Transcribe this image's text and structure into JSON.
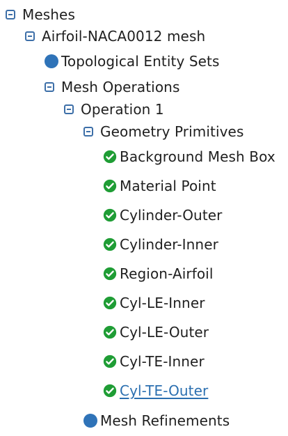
{
  "tree": {
    "root": {
      "label": "Meshes",
      "icon": "collapse-toggle-icon"
    },
    "mesh": {
      "label": "Airfoil-NACA0012 mesh",
      "icon": "collapse-toggle-icon"
    },
    "topological_entity_sets": {
      "label": "Topological Entity Sets",
      "icon": "blue-dot-icon"
    },
    "mesh_operations": {
      "label": "Mesh Operations",
      "icon": "collapse-toggle-icon"
    },
    "operation_1": {
      "label": "Operation 1",
      "icon": "collapse-toggle-icon"
    },
    "geometry_primitives": {
      "label": "Geometry Primitives",
      "icon": "collapse-toggle-icon"
    },
    "items": [
      {
        "label": "Background Mesh Box",
        "icon": "check-circle-icon"
      },
      {
        "label": "Material Point",
        "icon": "check-circle-icon"
      },
      {
        "label": "Cylinder-Outer",
        "icon": "check-circle-icon"
      },
      {
        "label": "Cylinder-Inner",
        "icon": "check-circle-icon"
      },
      {
        "label": "Region-Airfoil",
        "icon": "check-circle-icon"
      },
      {
        "label": "Cyl-LE-Inner",
        "icon": "check-circle-icon"
      },
      {
        "label": "Cyl-LE-Outer",
        "icon": "check-circle-icon"
      },
      {
        "label": "Cyl-TE-Inner",
        "icon": "check-circle-icon"
      },
      {
        "label": "Cyl-TE-Outer",
        "icon": "check-circle-icon"
      }
    ],
    "mesh_refinements": {
      "label": "Mesh Refinements",
      "icon": "blue-dot-icon"
    }
  },
  "colors": {
    "toggle": "#3d6fa8",
    "dot": "#2f73b8",
    "check": "#1f9d35",
    "selected": "#2b6fb0",
    "text": "#1f1f1f"
  }
}
